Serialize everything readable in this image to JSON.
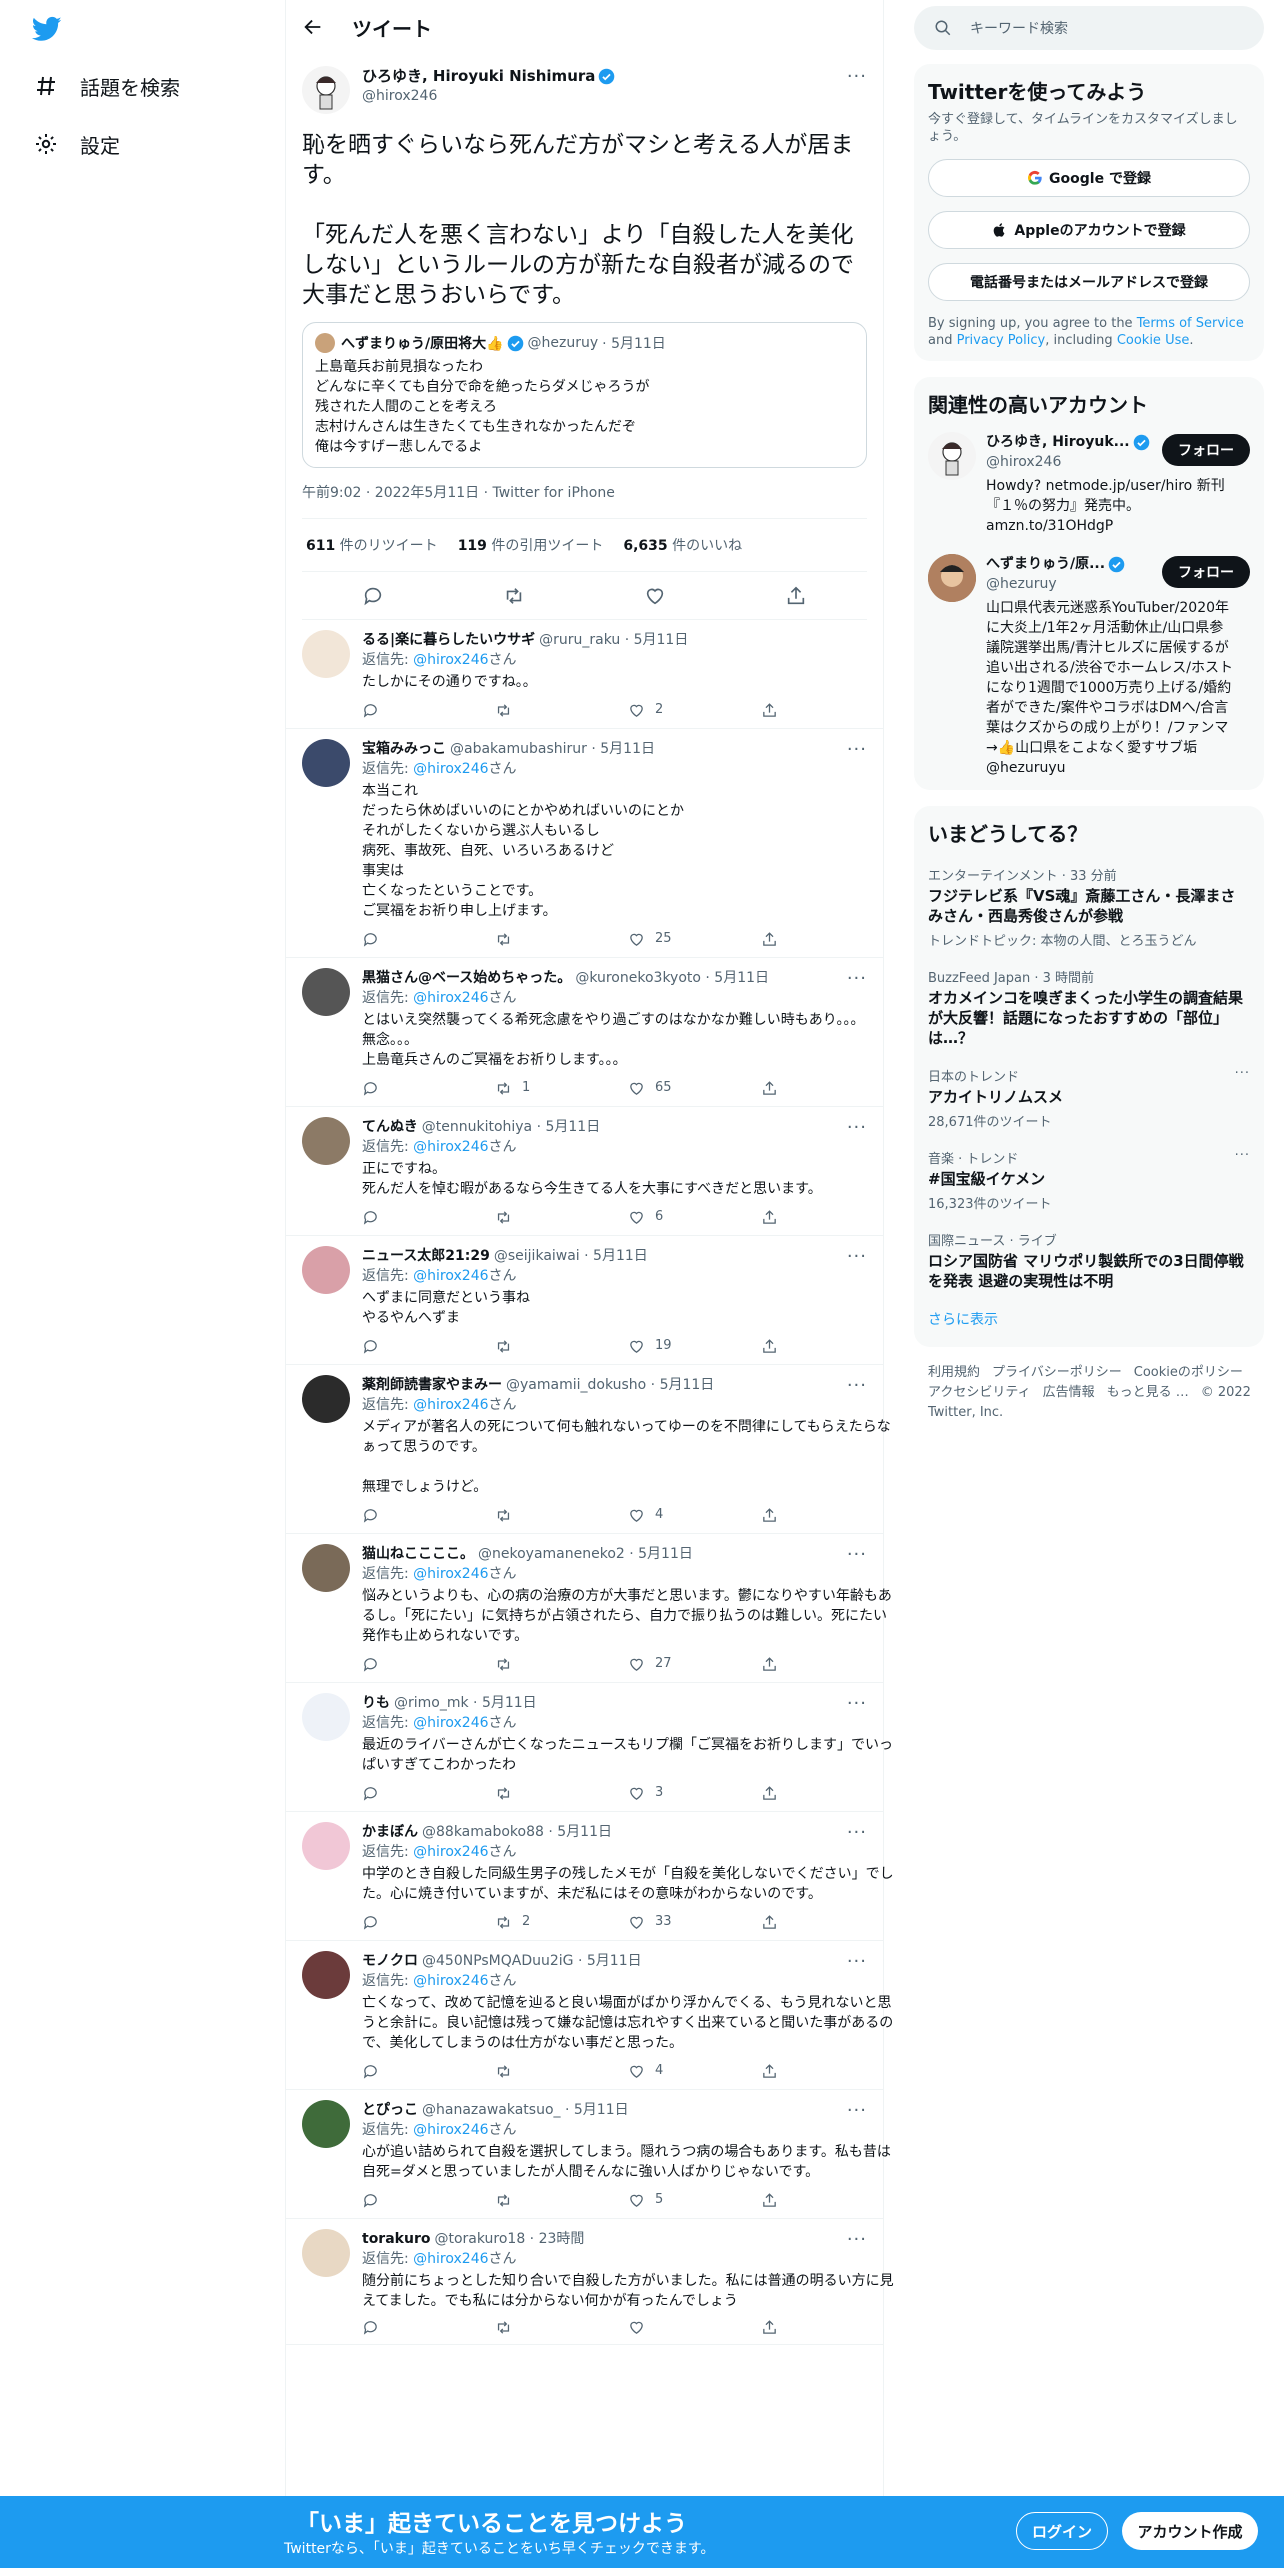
{
  "nav": {
    "explore_label": "話題を検索",
    "settings_label": "設定"
  },
  "header": {
    "title": "ツイート"
  },
  "focus_tweet": {
    "display_name": "ひろゆき, Hiroyuki Nishimura",
    "handle": "@hirox246",
    "text": "恥を晒すぐらいなら死んだ方がマシと考える人が居ます。\n\n「死んだ人を悪く言わない」より「自殺した人を美化しない」というルールの方が新たな自殺者が減るので大事だと思うおいらです。",
    "quote": {
      "display_name": "へずまりゅう/原田将大👍",
      "handle": "@hezuruy",
      "date": "· 5月11日",
      "text": "上島竜兵お前見損なったわ\nどんなに辛くても自分で命を絶ったらダメじゃろうが\n残された人間のことを考えろ\n志村けんさんは生きたくても生きれなかったんだぞ\n俺は今すげー悲しんでるよ"
    },
    "meta": "午前9:02 · 2022年5月11日 · Twitter for iPhone",
    "retweets_count": "611",
    "retweets_label": " 件のリツイート",
    "quotes_count": "119",
    "quotes_label": " 件の引用ツイート",
    "likes_count": "6,635",
    "likes_label": " 件のいいね"
  },
  "replying_prefix": "返信先: ",
  "replying_handle": "@hirox246",
  "replying_suffix": "さん",
  "replies": [
    {
      "name": "るる|楽に暮らしたいウサギ",
      "handle": "@ruru_raku · 5月11日",
      "text": "たしかにその通りですね。。",
      "rt": "",
      "likes": "2",
      "more": ""
    },
    {
      "name": "宝箱みみっこ",
      "handle": "@abakamubashirur · 5月11日",
      "text": "本当これ\nだったら休めばいいのにとかやめればいいのにとか\nそれがしたくないから選ぶ人もいるし\n病死、事故死、自死、いろいろあるけど\n事実は\n亡くなったということです。\nご冥福をお祈り申し上げます。",
      "rt": "",
      "likes": "25",
      "more": "···"
    },
    {
      "name": "黒猫さん@ベース始めちゃった。",
      "handle": "@kuroneko3kyoto · 5月11日",
      "text": "とはいえ突然襲ってくる希死念慮をやり過ごすのはなかなか難しい時もあり。。。\n無念。。。\n上島竜兵さんのご冥福をお祈りします。。。",
      "rt": "1",
      "likes": "65",
      "more": "···"
    },
    {
      "name": "てんぬき",
      "handle": "@tennukitohiya · 5月11日",
      "text": "正にですね。\n死んだ人を悼む暇があるなら今生きてる人を大事にすべきだと思います。",
      "rt": "",
      "likes": "6",
      "more": "···"
    },
    {
      "name": "ニュース太郎21:29",
      "handle": "@seijikaiwai · 5月11日",
      "text": "へずまに同意だという事ね\nやるやんへずま",
      "rt": "",
      "likes": "19",
      "more": "···"
    },
    {
      "name": "薬剤師読書家やまみー",
      "handle": "@yamamii_dokusho · 5月11日",
      "text": "メディアが著名人の死について何も触れないってゆーのを不問律にしてもらえたらなぁって思うのです。\n\n無理でしょうけど。",
      "rt": "",
      "likes": "4",
      "more": "···"
    },
    {
      "name": "猫山ねここここ。",
      "handle": "@nekoyamaneneko2 · 5月11日",
      "text": "悩みというよりも、心の病の治療の方が大事だと思います。鬱になりやすい年齢もあるし。「死にたい」に気持ちが占領されたら、自力で振り払うのは難しい。死にたい発作も止められないです。",
      "rt": "",
      "likes": "27",
      "more": "···"
    },
    {
      "name": "りも",
      "handle": "@rimo_mk · 5月11日",
      "text": "最近のライバーさんが亡くなったニュースもリプ欄「ご冥福をお祈りします」でいっぱいすぎてこわかったわ",
      "rt": "",
      "likes": "3",
      "more": "···"
    },
    {
      "name": "かまぼん",
      "handle": "@88kamaboko88 · 5月11日",
      "text": "中学のとき自殺した同級生男子の残したメモが「自殺を美化しないでください」でした。心に焼き付いていますが、未だ私にはその意味がわからないのです。",
      "rt": "2",
      "likes": "33",
      "more": "···"
    },
    {
      "name": "モノクロ",
      "handle": "@450NPsMQADuu2iG · 5月11日",
      "text": "亡くなって、改めて記憶を辿ると良い場面がばかり浮かんでくる、もう見れないと思うと余計に。良い記憶は残って嫌な記憶は忘れやすく出来ていると聞いた事があるので、美化してしまうのは仕方がない事だと思った。",
      "rt": "",
      "likes": "4",
      "more": "···"
    },
    {
      "name": "とぴっこ",
      "handle": "@hanazawakatsuo_ · 5月11日",
      "text": "心が追い詰められて自殺を選択してしまう。隠れうつ病の場合もあります。私も昔は自死=ダメと思っていましたが人間そんなに強い人ばかりじゃないです。",
      "rt": "",
      "likes": "5",
      "more": "···"
    },
    {
      "name": "torakuro",
      "handle": "@torakuro18 · 23時間",
      "text": "随分前にちょっとした知り合いで自殺した方がいました。私には普通の明るい方に見えてました。でも私には分からない何かが有ったんでしょう",
      "rt": "",
      "likes": "",
      "more": "···"
    }
  ],
  "search": {
    "placeholder": "キーワード検索"
  },
  "signup_card": {
    "title": "Twitterを使ってみよう",
    "subtitle": "今すぐ登録して、タイムラインをカスタマイズしましょう。",
    "google_label": "Google で登録",
    "apple_label": "Appleのアカウントで登録",
    "phone_label": "電話番号またはメールアドレスで登録",
    "terms_prefix": "By signing up, you agree to the ",
    "terms_link": "Terms of Service",
    "terms_and": " and ",
    "privacy_link": "Privacy Policy",
    "terms_including": ", including ",
    "cookie_link": "Cookie Use",
    "terms_end": "."
  },
  "related": {
    "title": "関連性の高いアカウント",
    "follow_label": "フォロー",
    "accounts": [
      {
        "name": "ひろゆき, Hiroyuk...",
        "handle": "@hirox246",
        "bio": "Howdy? netmode.jp/user/hiro 新刊『１％の努力』発売中。 amzn.to/31OHdgP"
      },
      {
        "name": "へずまりゅう/原...",
        "handle": "@hezuruy",
        "bio": "山口県代表元迷惑系YouTuber/2020年に大炎上/1年2ヶ月活動休止/山口県参議院選挙出馬/青汁ヒルズに居候するが追い出される/渋谷でホームレス/ホストになり1週間で1000万売り上げる/婚約者ができた/案件やコラボはDMへ/合言葉はクズからの成り上がり！/ファンマ→👍山口県をこよなく愛すサブ垢@hezuruyu"
      }
    ]
  },
  "trends": {
    "title": "いまどうしてる？",
    "items": [
      {
        "category": "エンターテインメント · 33 分前",
        "title": "フジテレビ系『VS魂』斎藤工さん・長澤まさみさん・西島秀俊さんが参戦",
        "extra": "トレンドトピック: 本物の人間、とろ玉うどん"
      },
      {
        "category": "BuzzFeed Japan · 3 時間前",
        "title": "オカメインコを嗅ぎまくった小学生の調査結果が大反響！話題になったおすすめの「部位」は…？",
        "extra": ""
      },
      {
        "category": "日本のトレンド",
        "title": "アカイトリノムスメ",
        "extra": "28,671件のツイート"
      },
      {
        "category": "音楽 · トレンド",
        "title": "#国宝級イケメン",
        "extra": "16,323件のツイート"
      },
      {
        "category": "国際ニュース · ライブ",
        "title": "ロシア国防省 マリウポリ製鉄所での3日間停戦を発表 退避の実現性は不明",
        "extra": ""
      }
    ],
    "show_more": "さらに表示"
  },
  "footer": {
    "links": [
      "利用規約",
      "プライバシーポリシー",
      "Cookieのポリシー",
      "アクセシビリティ",
      "広告情報",
      "もっと見る …",
      "© 2022 Twitter, Inc."
    ]
  },
  "banner": {
    "title": "「いま」起きていることを見つけよう",
    "subtitle": "Twitterなら、「いま」起きていることをいち早くチェックできます。",
    "login_label": "ログイン",
    "signup_label": "アカウント作成"
  },
  "colors": {
    "accent": "#1d9bf0",
    "text": "#0f1419",
    "muted": "#536471"
  }
}
